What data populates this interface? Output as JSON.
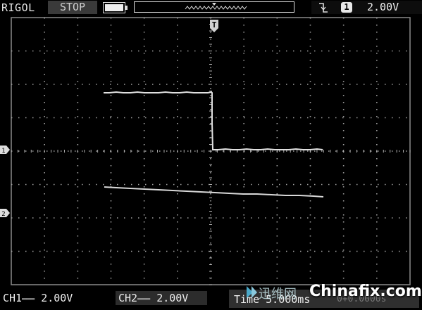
{
  "header": {
    "brand": "RIGOL",
    "run_status": "STOP",
    "trigger_channel": "1",
    "trigger_level": "2.00V"
  },
  "footer": {
    "ch1_label": "CH1",
    "ch1_scale": "2.00V",
    "ch2_label": "CH2",
    "ch2_scale": "2.00V",
    "timebase": "Time 5.000ms",
    "ghost_readout": "0+0.0000s"
  },
  "markers": {
    "trigger_position": "T",
    "ch1_marker": "1",
    "ch2_marker": "2"
  },
  "watermark": {
    "cn": "迅维网",
    "en": "Chinafix.com"
  },
  "colors": {
    "background": "#000000",
    "trace": "#e0e0e0",
    "grid": "#9a9a9a",
    "status_bg": "#3a3a3a"
  },
  "icons": {
    "battery": "battery-icon",
    "trigger_edge": "falling-edge-icon",
    "trigger_pos": "trigger-position-icon"
  }
}
